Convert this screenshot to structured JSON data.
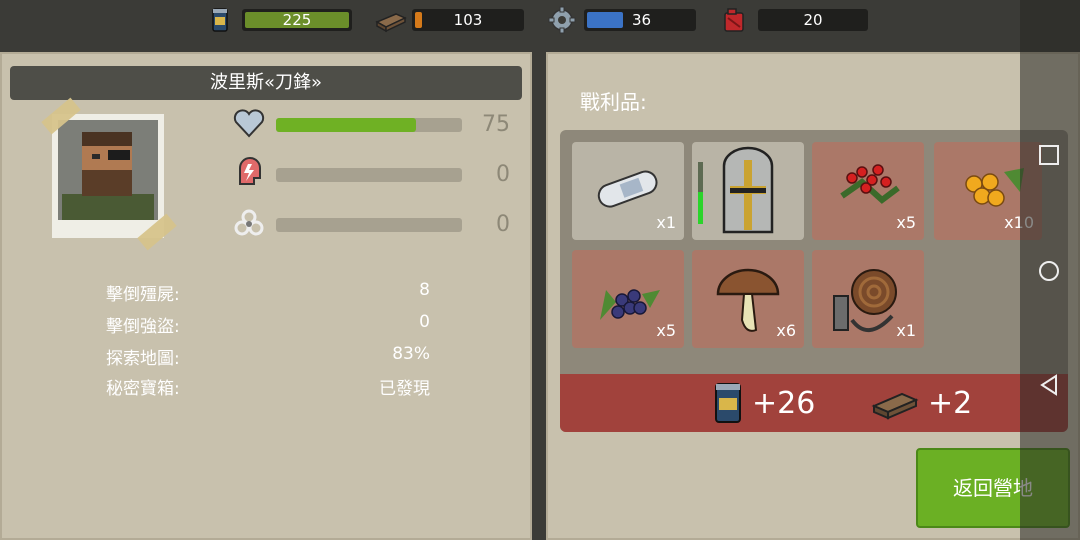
{
  "resources": [
    {
      "name": "food",
      "icon": "canned-food-icon",
      "value": "225",
      "bar_color": "#6b8e2a",
      "fill": 1.0
    },
    {
      "name": "wood",
      "icon": "wood-plank-icon",
      "value": "103",
      "bar_color": "#d57a1a",
      "fill": 0.06
    },
    {
      "name": "water",
      "icon": "gear-icon",
      "value": "36",
      "bar_color": "#3b73c6",
      "fill": 0.5
    },
    {
      "name": "fuel",
      "icon": "fuel-can-icon",
      "value": "20",
      "bar_color": "#c0282b",
      "fill": 0.0
    }
  ],
  "survivor": {
    "name": "波里斯«刀鋒»",
    "health": {
      "value": "75",
      "fill": 0.75
    },
    "stress": {
      "value": "0",
      "fill": 0
    },
    "infection": {
      "value": "0",
      "fill": 0
    }
  },
  "stats": [
    {
      "label": "擊倒殭屍:",
      "value": "8"
    },
    {
      "label": "擊倒強盜:",
      "value": "0"
    },
    {
      "label": "探索地圖:",
      "value": "83%"
    },
    {
      "label": "秘密寶箱:",
      "value": "已發現"
    }
  ],
  "loot": {
    "title": "戰利品:",
    "items": [
      {
        "icon": "bandage-icon",
        "qty": "x1",
        "style": "plain"
      },
      {
        "icon": "knight-helmet-icon",
        "qty": "",
        "style": "plain"
      },
      {
        "icon": "red-berries-icon",
        "qty": "x5",
        "style": "red"
      },
      {
        "icon": "orange-berries-icon",
        "qty": "x10",
        "style": "red"
      },
      {
        "icon": "blueberries-icon",
        "qty": "x5",
        "style": "red"
      },
      {
        "icon": "mushroom-icon",
        "qty": "x6",
        "style": "red"
      },
      {
        "icon": "rope-icon",
        "qty": "x1",
        "style": "red"
      }
    ],
    "rewards": [
      {
        "icon": "canned-food-icon",
        "value": "+26"
      },
      {
        "icon": "wood-plank-icon",
        "value": "+2"
      }
    ],
    "return_label": "返回營地"
  },
  "colors": {
    "accent": "#6bb024",
    "panel": "#c8c1ad",
    "reward": "#a1423c"
  }
}
